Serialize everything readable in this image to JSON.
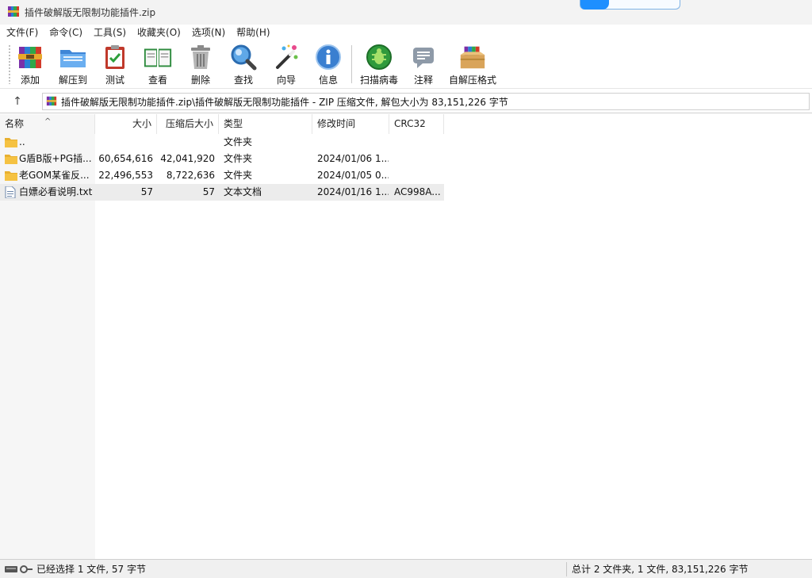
{
  "window": {
    "title": "插件破解版无限制功能插件.zip"
  },
  "menu": [
    "文件(F)",
    "命令(C)",
    "工具(S)",
    "收藏夹(O)",
    "选项(N)",
    "帮助(H)"
  ],
  "toolbar": {
    "add": "添加",
    "extract_to": "解压到",
    "test": "测试",
    "view": "查看",
    "delete": "删除",
    "find": "查找",
    "wizard": "向导",
    "info": "信息",
    "virus_scan": "扫描病毒",
    "comment": "注释",
    "sfx": "自解压格式"
  },
  "address": {
    "up_glyph": "↑",
    "path": "插件破解版无限制功能插件.zip\\插件破解版无限制功能插件 - ZIP 压缩文件, 解包大小为 83,151,226 字节"
  },
  "columns": {
    "name": "名称",
    "size": "大小",
    "packed": "压缩后大小",
    "type": "类型",
    "modified": "修改时间",
    "crc": "CRC32"
  },
  "files": [
    {
      "name": "..",
      "size": "",
      "packed": "",
      "type": "文件夹",
      "modified": "",
      "crc": "",
      "icon": "folder-icon"
    },
    {
      "name": "G盾B版+PG插...",
      "size": "60,654,616",
      "packed": "42,041,920",
      "type": "文件夹",
      "modified": "2024/01/06 1...",
      "crc": "",
      "icon": "folder-icon"
    },
    {
      "name": "老GOM某雀反...",
      "size": "22,496,553",
      "packed": "8,722,636",
      "type": "文件夹",
      "modified": "2024/01/05 0...",
      "crc": "",
      "icon": "folder-icon"
    },
    {
      "name": "白嫖必看说明.txt",
      "size": "57",
      "packed": "57",
      "type": "文本文档",
      "modified": "2024/01/16 1...",
      "crc": "AC998A...",
      "icon": "text-file-icon"
    }
  ],
  "status": {
    "left": "已经选择 1 文件, 57 字节",
    "right": "总计 2 文件夹, 1 文件, 83,151,226 字节"
  },
  "colors": {
    "accent": "#1e8fff",
    "selection": "#ececec",
    "folder": "#f5c242"
  }
}
